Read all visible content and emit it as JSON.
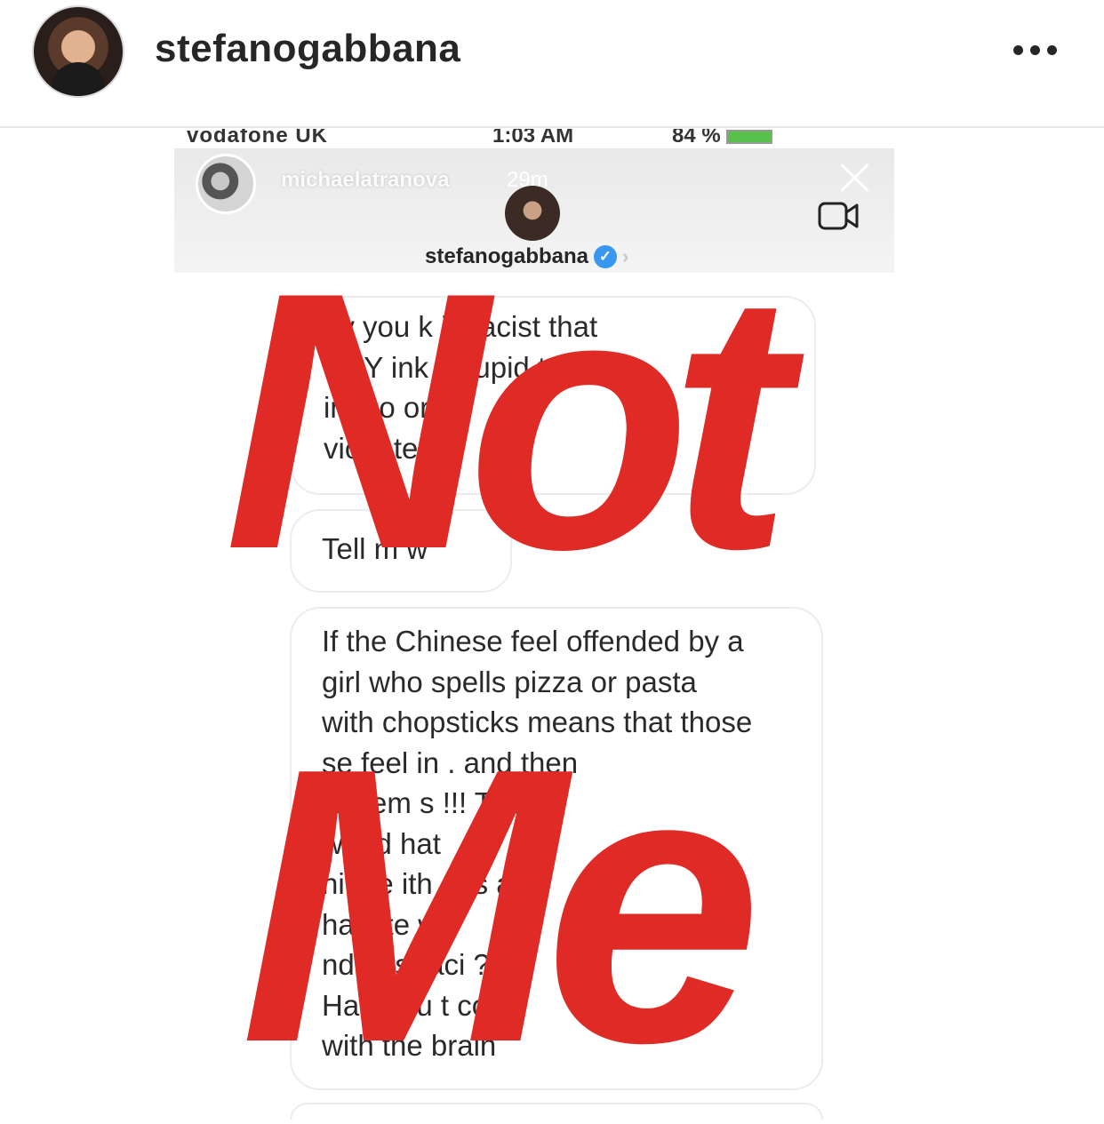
{
  "post": {
    "username": "stefanogabbana",
    "more_icon": "more-horizontal-icon"
  },
  "status_bar": {
    "carrier": "vodafone UK",
    "time": "1:03 AM",
    "battery": "84 %"
  },
  "story": {
    "name": "michaelatranova",
    "time": "29m"
  },
  "dm": {
    "username": "stefanogabbana",
    "verified_icon": "verified-badge-icon"
  },
  "messages": [
    {
      "lines": [
        "hy you  k is racist that",
        "o? Y  ink w  tupid to",
        "  in  a  o  or",
        "vio  a  te"
      ]
    },
    {
      "lines": [
        "Tell m  w"
      ]
    },
    {
      "lines": [
        "If the Chinese feel offended by a",
        "girl who spells pizza or pasta",
        "with chopsticks means that those",
        "  se feel in  . and then",
        "  roblem  s !!! The",
        "  world  hat",
        "hi  e e  ith  ops  and",
        "hat  ste  w",
        "nd  !! Is  raci  ?",
        "Haha  ou  t com",
        "with the brain"
      ]
    }
  ],
  "overlay": {
    "word1": "Not",
    "word2": "Me",
    "color": "#df2a26"
  }
}
